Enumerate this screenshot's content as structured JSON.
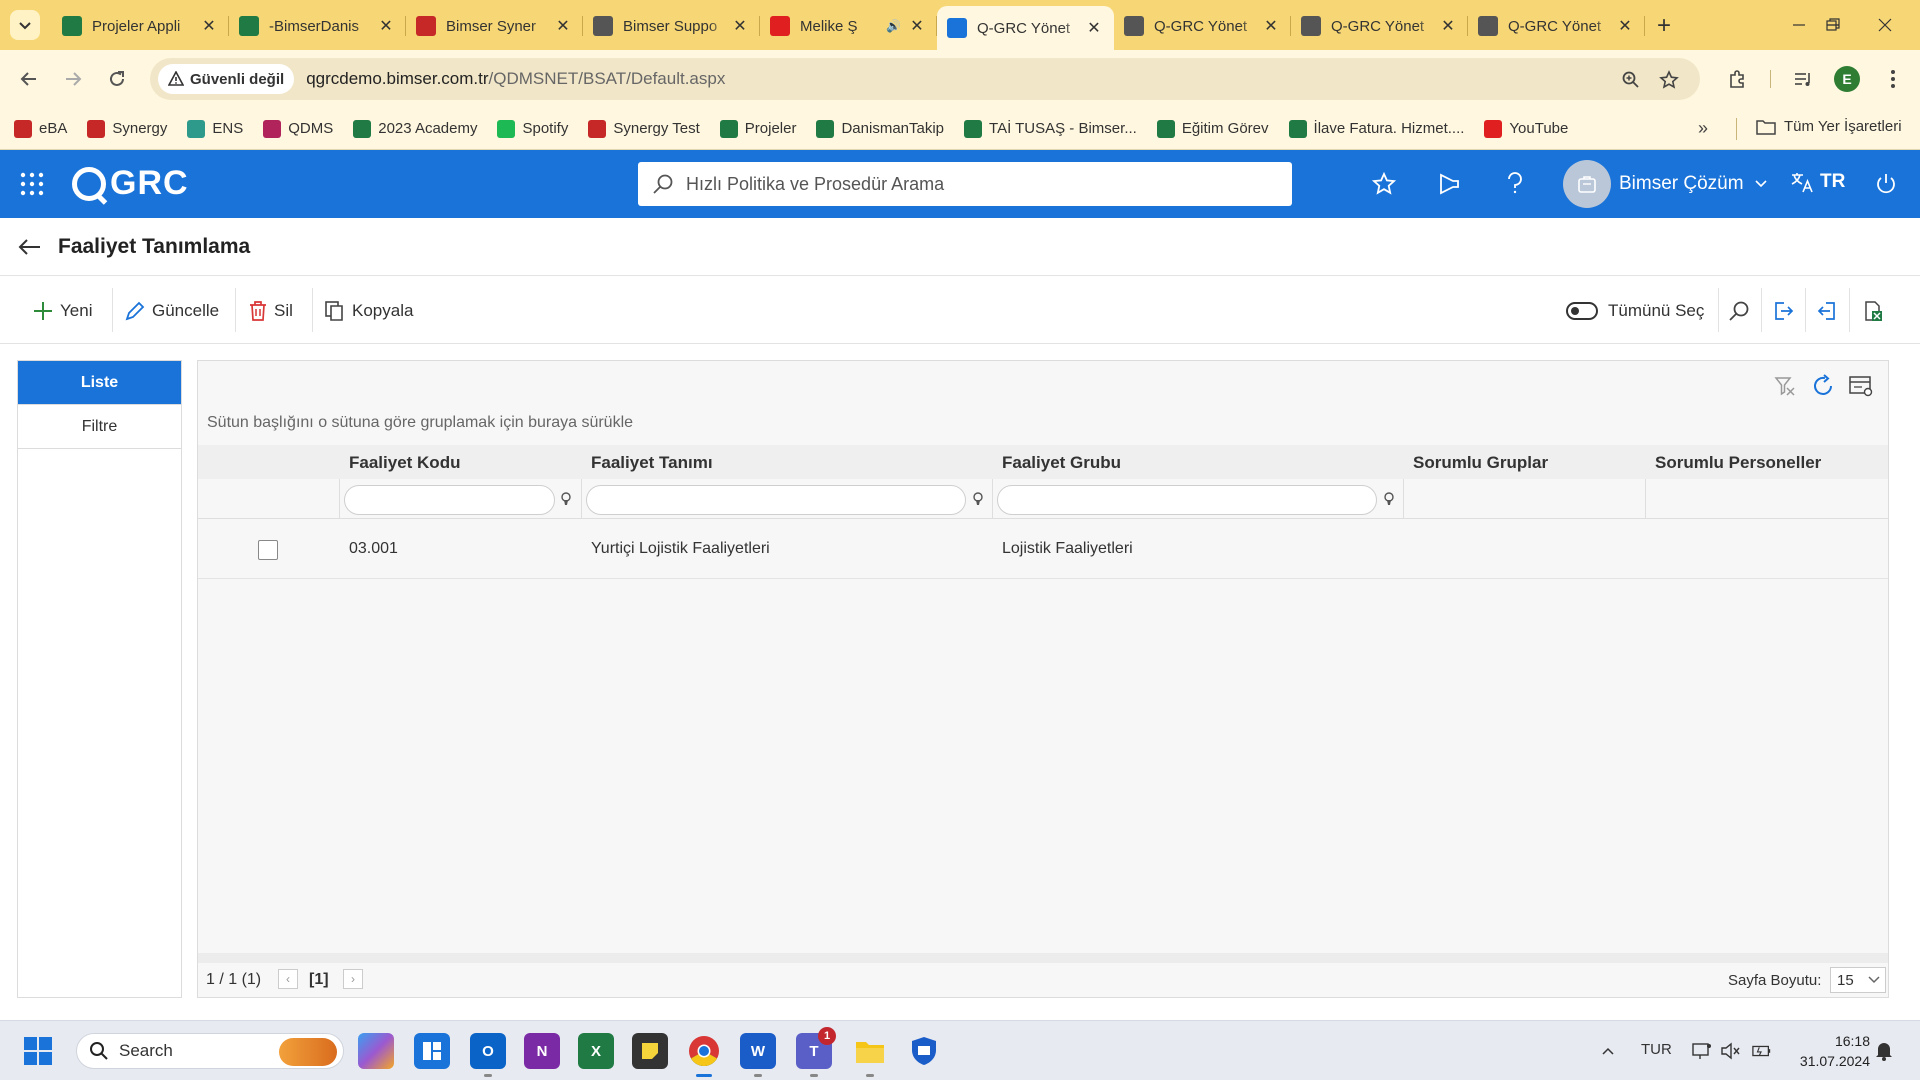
{
  "browser": {
    "tabs": [
      {
        "title": "Projeler Appli",
        "icon": "excel-icon",
        "color": "#1f7a44"
      },
      {
        "title": "-BimserDanis",
        "icon": "excel-icon",
        "color": "#1f7a44"
      },
      {
        "title": "Bimser Syner",
        "icon": "synergy-icon",
        "color": "#c62828"
      },
      {
        "title": "Bimser Suppo",
        "icon": "globe-icon",
        "color": "#555555"
      },
      {
        "title": "Melike Ş",
        "icon": "youtube-icon",
        "color": "#e02020"
      },
      {
        "title": "Q-GRC Yönet",
        "icon": "qgrc-icon",
        "color": "#1a73d9",
        "active": true
      },
      {
        "title": "Q-GRC Yönet",
        "icon": "globe-icon",
        "color": "#555555"
      },
      {
        "title": "Q-GRC Yönet",
        "icon": "globe-icon",
        "color": "#555555"
      },
      {
        "title": "Q-GRC Yönet",
        "icon": "globe-icon",
        "color": "#555555"
      }
    ],
    "security_label": "Güvenli değil",
    "url_host": "qgrcdemo.bimser.com.tr",
    "url_path": "/QDMSNET/BSAT/Default.aspx",
    "profile_initial": "E",
    "bookmarks": [
      {
        "label": "eBA",
        "color": "#c62828",
        "icon": "eba-icon"
      },
      {
        "label": "Synergy",
        "color": "#c62828",
        "icon": "synergy-icon"
      },
      {
        "label": "ENS",
        "color": "#2e9a8c",
        "icon": "ens-icon"
      },
      {
        "label": "QDMS",
        "color": "#b0245b",
        "icon": "qdms-icon"
      },
      {
        "label": "2023 Academy",
        "color": "#1f7a44",
        "icon": "excel-icon"
      },
      {
        "label": "Spotify",
        "color": "#1db954",
        "icon": "spotify-icon"
      },
      {
        "label": "Synergy Test",
        "color": "#c62828",
        "icon": "synergy-icon"
      },
      {
        "label": "Projeler",
        "color": "#1f7a44",
        "icon": "excel-icon"
      },
      {
        "label": "DanismanTakip",
        "color": "#1f7a44",
        "icon": "excel-icon"
      },
      {
        "label": "TAİ TUSAŞ - Bimser...",
        "color": "#1f7a44",
        "icon": "excel-icon"
      },
      {
        "label": "Eğitim Görev",
        "color": "#1f7a44",
        "icon": "excel-icon"
      },
      {
        "label": "İlave Fatura. Hizmet....",
        "color": "#1f7a44",
        "icon": "excel-icon"
      },
      {
        "label": "YouTube",
        "color": "#e02020",
        "icon": "youtube-icon"
      }
    ],
    "all_bookmarks_label": "Tüm Yer İşaretleri"
  },
  "app": {
    "logo_text": "GRC",
    "search_placeholder": "Hızlı Politika ve Prosedür Arama",
    "user_name": "Bimser Çözüm",
    "language": "TR",
    "accent_color": "#1a73d9"
  },
  "page": {
    "title": "Faaliyet Tanımlama",
    "actions": {
      "new": "Yeni",
      "update": "Güncelle",
      "delete": "Sil",
      "copy": "Kopyala",
      "select_all": "Tümünü Seç"
    },
    "left_tabs": {
      "list": "Liste",
      "filter": "Filtre"
    },
    "grid": {
      "group_hint": "Sütun başlığını o sütuna göre gruplamak için buraya sürükle",
      "columns": [
        "Faaliyet Kodu",
        "Faaliyet Tanımı",
        "Faaliyet Grubu",
        "Sorumlu Gruplar",
        "Sorumlu Personeller"
      ],
      "rows": [
        {
          "code": "03.001",
          "name": "Yurtiçi Lojistik Faaliyetleri",
          "group": "Lojistik Faaliyetleri",
          "resp_groups": "",
          "resp_people": ""
        }
      ],
      "pager_info": "1 / 1 (1)",
      "current_page": "[1]",
      "page_size_label": "Sayfa Boyutu:",
      "page_size": "15"
    }
  },
  "taskbar": {
    "search_label": "Search",
    "language": "TUR",
    "time": "16:18",
    "date": "31.07.2024",
    "teams_badge": "1"
  }
}
